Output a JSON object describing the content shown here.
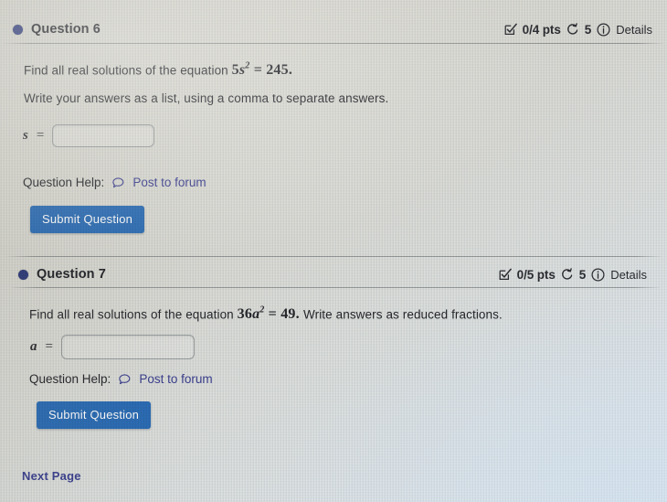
{
  "page": {
    "next_page_label": "Next Page"
  },
  "questions": [
    {
      "title": "Question 6",
      "status_icon": "checkbox-check-icon",
      "points": "0/4 pts",
      "attempts_icon": "counterclockwise-arrow-icon",
      "attempts": "5",
      "info_icon": "info-circle-icon",
      "details_label": "Details",
      "prompt_prefix": "Find all real solutions of the equation",
      "equation": {
        "coefficient": "5",
        "variable": "s",
        "exponent": "2",
        "relation": "=",
        "value": "245",
        "terminator": "."
      },
      "instruction": "Write your answers as a list, using a comma to separate answers.",
      "answer_variable": "s",
      "answer_equals": "=",
      "answer_value": "",
      "answer_placeholder": "",
      "help_label": "Question Help:",
      "forum_icon": "speech-bubble-icon",
      "forum_link": "Post to forum",
      "submit_label": "Submit Question"
    },
    {
      "title": "Question 7",
      "status_icon": "checkbox-check-icon",
      "points": "0/5 pts",
      "attempts_icon": "counterclockwise-arrow-icon",
      "attempts": "5",
      "info_icon": "info-circle-icon",
      "details_label": "Details",
      "prompt_prefix": "Find all real solutions of the equation",
      "equation": {
        "coefficient": "36",
        "variable": "a",
        "exponent": "2",
        "relation": "=",
        "value": "49",
        "terminator": "."
      },
      "instruction": "Write answers as reduced fractions.",
      "answer_variable": "a",
      "answer_equals": "=",
      "answer_value": "",
      "answer_placeholder": "",
      "help_label": "Question Help:",
      "forum_icon": "speech-bubble-icon",
      "forum_link": "Post to forum",
      "submit_label": "Submit Question"
    }
  ],
  "colors": {
    "question_dot": "#2d3a7a",
    "link": "#3b3f8f",
    "submit_button": "#2a6cb5",
    "text": "#26272c"
  }
}
